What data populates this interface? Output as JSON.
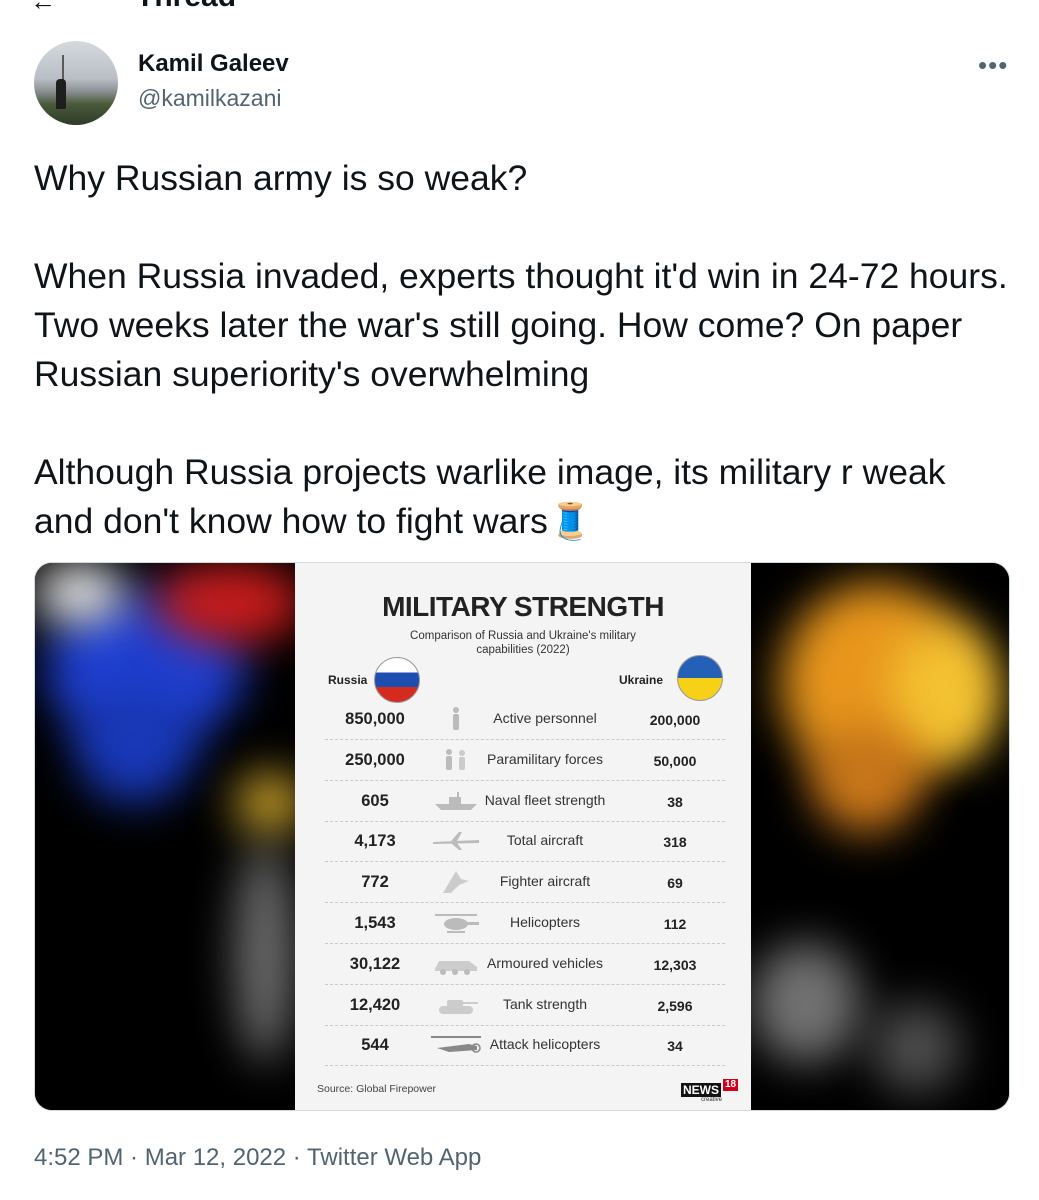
{
  "header": {
    "back_icon": "arrow-left-icon",
    "title": "Thread"
  },
  "author": {
    "name": "Kamil Galeev",
    "handle": "@kamilkazani"
  },
  "tweet": {
    "text": "Why Russian army is so weak?\n\nWhen Russia invaded, experts thought it'd win in 24-72 hours. Two weeks later the war's still going. How come? On paper Russian superiority's overwhelming\n\nAlthough Russia projects warlike image, its military r weak and don't know how to fight wars",
    "emoji": "🧵"
  },
  "more_label": "•••",
  "infographic": {
    "title": "MILITARY STRENGTH",
    "subtitle": "Comparison of Russia and Ukraine's military capabilities (2022)",
    "left_country": "Russia",
    "right_country": "Ukraine",
    "source": "Source: Global Firepower",
    "logo_text": "NEWS",
    "logo_number": "18",
    "logo_sub": "creative",
    "rows": [
      {
        "russia": "850,000",
        "label": "Active personnel",
        "ukraine": "200,000",
        "icon": "soldier-icon"
      },
      {
        "russia": "250,000",
        "label": "Paramilitary forces",
        "ukraine": "50,000",
        "icon": "paramilitary-icon"
      },
      {
        "russia": "605",
        "label": "Naval fleet strength",
        "ukraine": "38",
        "icon": "ship-icon"
      },
      {
        "russia": "4,173",
        "label": "Total aircraft",
        "ukraine": "318",
        "icon": "airplane-icon"
      },
      {
        "russia": "772",
        "label": "Fighter aircraft",
        "ukraine": "69",
        "icon": "fighter-jet-icon"
      },
      {
        "russia": "1,543",
        "label": "Helicopters",
        "ukraine": "112",
        "icon": "helicopter-icon"
      },
      {
        "russia": "30,122",
        "label": "Armoured vehicles",
        "ukraine": "12,303",
        "icon": "armoured-vehicle-icon"
      },
      {
        "russia": "12,420",
        "label": "Tank strength",
        "ukraine": "2,596",
        "icon": "tank-icon"
      },
      {
        "russia": "544",
        "label": "Attack helicopters",
        "ukraine": "34",
        "icon": "attack-helicopter-icon"
      }
    ]
  },
  "meta": {
    "text": "4:52 PM · Mar 12, 2022 · Twitter Web App"
  }
}
